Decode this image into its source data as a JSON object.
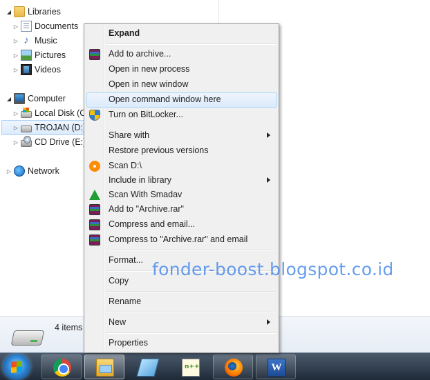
{
  "nav_pane": {
    "libraries": {
      "label": "Libraries",
      "children": [
        {
          "label": "Documents",
          "icon": "documents-icon"
        },
        {
          "label": "Music",
          "icon": "music-icon"
        },
        {
          "label": "Pictures",
          "icon": "pictures-icon"
        },
        {
          "label": "Videos",
          "icon": "videos-icon"
        }
      ]
    },
    "computer": {
      "label": "Computer",
      "children": [
        {
          "label": "Local Disk (C:",
          "icon": "local-disk-icon"
        },
        {
          "label": "TROJAN (D:)",
          "icon": "drive-icon",
          "selected": true
        },
        {
          "label": "CD Drive (E:)",
          "icon": "cd-drive-icon"
        }
      ]
    },
    "network": {
      "label": "Network"
    }
  },
  "details_pane": {
    "items_count": "4 items"
  },
  "context_menu": {
    "items": [
      {
        "label": "Expand",
        "bold": true
      },
      {
        "label": "Add to archive...",
        "icon": "winrar-icon"
      },
      {
        "label": "Open in new process"
      },
      {
        "label": "Open in new window"
      },
      {
        "label": "Open command window here",
        "highlighted": true
      },
      {
        "label": "Turn on BitLocker...",
        "icon": "uac-shield-icon"
      },
      {
        "label": "Share with",
        "submenu": true
      },
      {
        "label": "Restore previous versions"
      },
      {
        "label": "Scan D:\\",
        "icon": "avast-icon"
      },
      {
        "label": "Include in library",
        "submenu": true
      },
      {
        "label": "Scan With Smadav",
        "icon": "smadav-icon"
      },
      {
        "label": "Add to \"Archive.rar\"",
        "icon": "winrar-icon"
      },
      {
        "label": "Compress and email...",
        "icon": "winrar-icon"
      },
      {
        "label": "Compress to \"Archive.rar\" and email",
        "icon": "winrar-icon"
      },
      {
        "label": "Format..."
      },
      {
        "label": "Copy"
      },
      {
        "label": "Rename"
      },
      {
        "label": "New",
        "submenu": true
      },
      {
        "label": "Properties"
      }
    ]
  },
  "taskbar": {
    "apps": [
      {
        "name": "chrome",
        "icon": "chrome-icon"
      },
      {
        "name": "windows-explorer",
        "icon": "explorer-icon",
        "active": true
      },
      {
        "name": "notepad",
        "icon": "notepad-icon"
      },
      {
        "name": "notepad-plus-plus",
        "icon": "notepad-plus-plus-icon"
      },
      {
        "name": "firefox",
        "icon": "firefox-icon"
      },
      {
        "name": "word",
        "icon": "word-icon",
        "glyph": "W"
      }
    ]
  },
  "watermark": {
    "text": "fonder-boost.blogspot.co.id"
  },
  "colors": {
    "menu_background": "#f0f0f0",
    "menu_highlight_border": "#a8d8fb",
    "selection_border": "#a9cff4",
    "watermark": "#3c82eb",
    "taskbar": "#1f2a38"
  }
}
